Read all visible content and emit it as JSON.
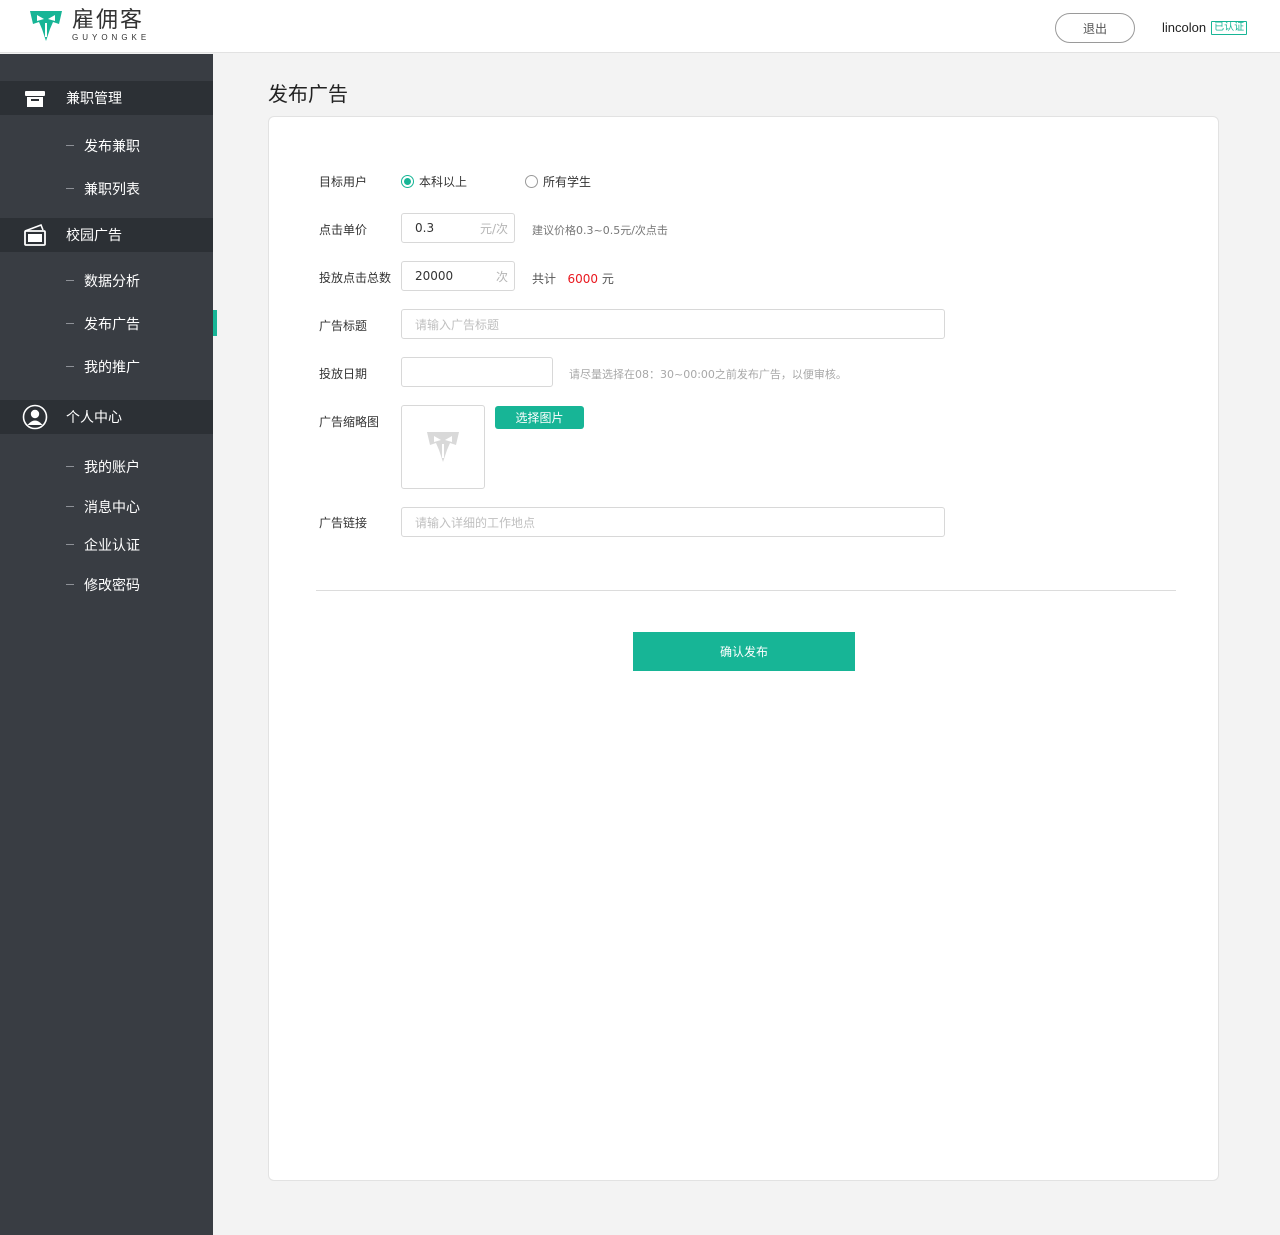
{
  "header": {
    "logo_cn": "雇佣客",
    "logo_en": "GUYONGKE",
    "logout_label": "退出",
    "username": "lincolon",
    "verified_label": "已认证"
  },
  "sidebar": {
    "groups": [
      {
        "label": "兼职管理",
        "icon": "briefcase-icon",
        "items": [
          "发布兼职",
          "兼职列表"
        ]
      },
      {
        "label": "校园广告",
        "icon": "wallet-icon",
        "items": [
          "数据分析",
          "发布广告",
          "我的推广"
        ]
      },
      {
        "label": "个人中心",
        "icon": "user-icon",
        "items": [
          "我的账户",
          "消息中心",
          "企业认证",
          "修改密码"
        ]
      }
    ],
    "active_item": "发布广告"
  },
  "page": {
    "title": "发布广告"
  },
  "form": {
    "target_users": {
      "label": "目标用户",
      "options": [
        "本科以上",
        "所有学生"
      ],
      "selected": "本科以上"
    },
    "unit_price": {
      "label": "点击单价",
      "value": "0.3",
      "suffix": "元/次",
      "hint": "建议价格0.3~0.5元/次点击"
    },
    "total_clicks": {
      "label": "投放点击总数",
      "value": "20000",
      "suffix": "次",
      "total_prefix": "共计",
      "total_value": "6000",
      "total_unit": "元"
    },
    "ad_title": {
      "label": "广告标题",
      "placeholder": "请输入广告标题"
    },
    "ad_date": {
      "label": "投放日期",
      "value": "",
      "hint": "请尽量选择在08：30~00:00之前发布广告，以便审核。"
    },
    "thumbnail": {
      "label": "广告缩略图",
      "button_label": "选择图片"
    },
    "ad_link": {
      "label": "广告链接",
      "placeholder": "请输入详细的工作地点"
    },
    "submit_label": "确认发布"
  },
  "colors": {
    "accent": "#17b596",
    "sidebar_bg": "#393d43",
    "sidebar_header_bg": "#2c3035",
    "highlight_red": "#e9181f"
  }
}
